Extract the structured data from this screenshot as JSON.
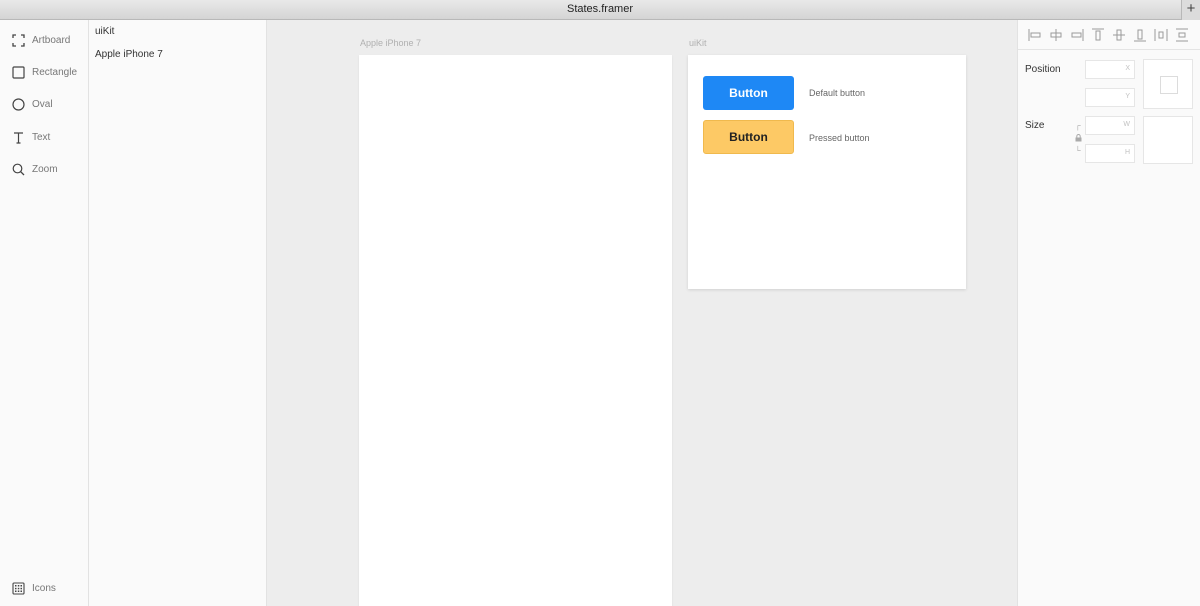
{
  "window": {
    "title": "States.framer",
    "plus_label": "+"
  },
  "tools": {
    "items": [
      {
        "id": "artboard",
        "label": "Artboard",
        "icon": "artboard-icon"
      },
      {
        "id": "rectangle",
        "label": "Rectangle",
        "icon": "rectangle-icon"
      },
      {
        "id": "oval",
        "label": "Oval",
        "icon": "oval-icon"
      },
      {
        "id": "text",
        "label": "Text",
        "icon": "text-icon"
      },
      {
        "id": "zoom",
        "label": "Zoom",
        "icon": "zoom-icon"
      }
    ],
    "bottom": {
      "label": "Icons",
      "icon": "icons-grid-icon"
    }
  },
  "layers": {
    "items": [
      {
        "label": "uiKit"
      },
      {
        "label": "Apple iPhone 7"
      }
    ]
  },
  "canvas": {
    "phone_label": "Apple iPhone 7",
    "uikit_label": "uiKit",
    "uikit": {
      "default_button": {
        "label": "Button",
        "desc": "Default button",
        "color": "#1e88f5"
      },
      "pressed_button": {
        "label": "Button",
        "desc": "Pressed button",
        "color": "#fdc965"
      }
    }
  },
  "inspector": {
    "align_icons": [
      "align-left-icon",
      "align-center-horizontal-icon",
      "align-right-icon",
      "align-top-icon",
      "align-middle-vertical-icon",
      "align-bottom-icon",
      "distribute-horizontal-icon",
      "distribute-vertical-icon"
    ],
    "position_label": "Position",
    "size_label": "Size",
    "fields": {
      "x": "X",
      "y": "Y",
      "w": "W",
      "h": "H"
    }
  }
}
